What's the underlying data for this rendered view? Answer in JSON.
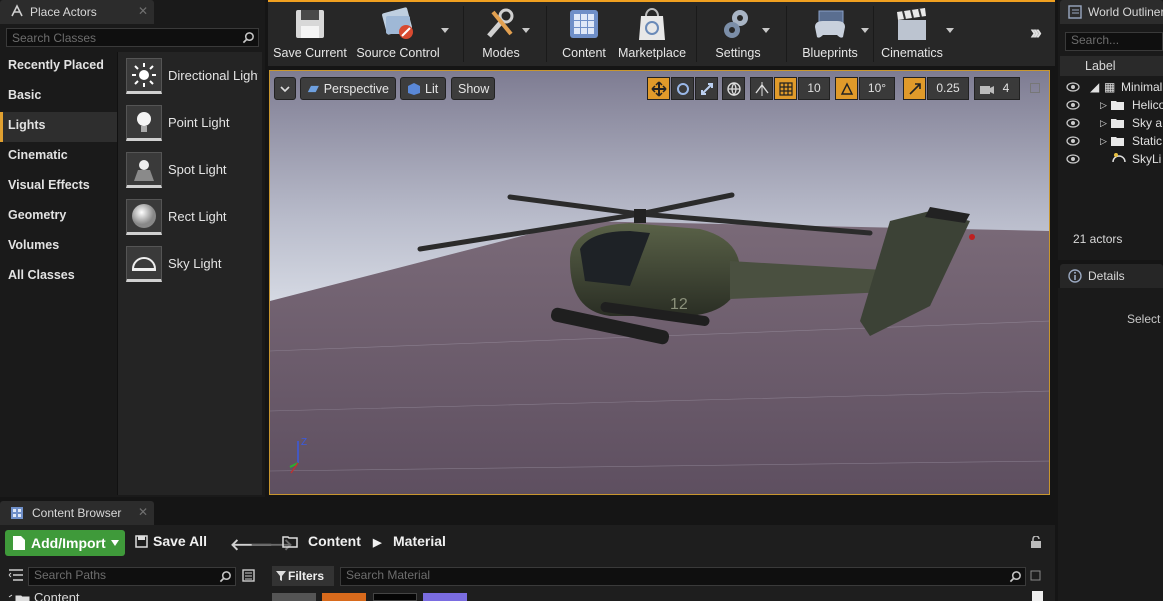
{
  "place_actors": {
    "tab_title": "Place Actors",
    "search_placeholder": "Search Classes",
    "categories": [
      "Recently Placed",
      "Basic",
      "Lights",
      "Cinematic",
      "Visual Effects",
      "Geometry",
      "Volumes",
      "All Classes"
    ],
    "active_category": "Lights",
    "items": [
      "Directional Light",
      "Point Light",
      "Spot Light",
      "Rect Light",
      "Sky Light"
    ]
  },
  "toolbar": {
    "buttons": [
      {
        "label": "Save Current",
        "icon": "floppy-disk-icon"
      },
      {
        "label": "Source Control",
        "icon": "source-control-icon"
      },
      {
        "label": "Modes",
        "icon": "wrench-icon"
      },
      {
        "label": "Content",
        "icon": "grid-icon"
      },
      {
        "label": "Marketplace",
        "icon": "shopping-bag-icon"
      },
      {
        "label": "Settings",
        "icon": "gears-icon"
      },
      {
        "label": "Blueprints",
        "icon": "gamepad-icon"
      },
      {
        "label": "Cinematics",
        "icon": "clapperboard-icon"
      }
    ],
    "accent": "#f0a020"
  },
  "viewport": {
    "perspective_label": "Perspective",
    "lit_label": "Lit",
    "show_label": "Show",
    "grid_snap": "10",
    "rotation_snap": "10°",
    "scale_snap": "0.25",
    "camera_speed": "4",
    "fuselage_number": "12",
    "axis_label": "Z"
  },
  "world_outliner": {
    "tab_title": "World Outliner",
    "search_placeholder": "Search...",
    "column_label": "Label",
    "rows": [
      "Minimal",
      "Helico",
      "Sky a",
      "Static",
      "SkyLi"
    ],
    "actor_count": "21 actors"
  },
  "details": {
    "tab_title": "Details",
    "hint": "Select"
  },
  "content_browser": {
    "tab_title": "Content Browser",
    "add_import_label": "Add/Import",
    "save_all_label": "Save All",
    "breadcrumb": [
      "Content",
      "Material"
    ],
    "paths_placeholder": "Search Paths",
    "filters_label": "Filters",
    "material_placeholder": "Search Material",
    "tree_root": "Content"
  }
}
